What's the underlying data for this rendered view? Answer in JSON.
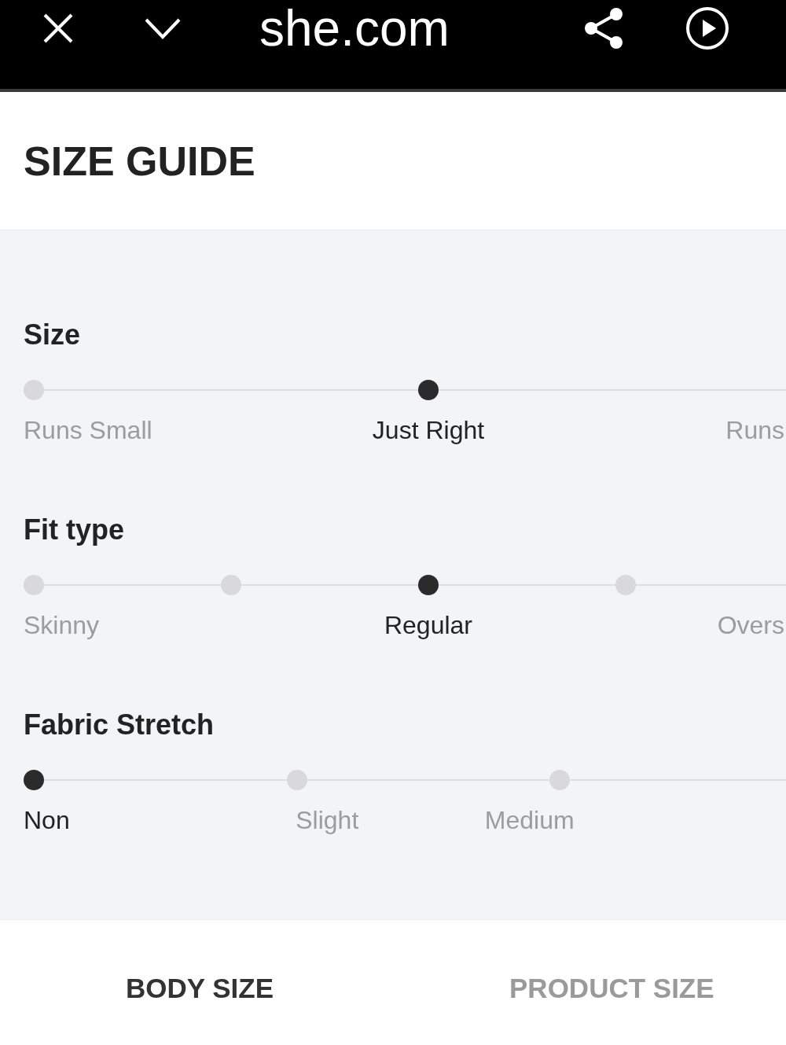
{
  "browser_bar": {
    "address": "she.com"
  },
  "header": {
    "title": "SIZE GUIDE"
  },
  "fit_scales": [
    {
      "title": "Size",
      "stops": [
        {
          "selected": false
        },
        {
          "selected": true
        }
      ],
      "labels": [
        {
          "text": "Runs Small",
          "selected": false
        },
        {
          "text": "Just Right",
          "selected": true
        },
        {
          "text": "Runs",
          "selected": false
        }
      ]
    },
    {
      "title": "Fit type",
      "stops": [
        {
          "selected": false
        },
        {
          "selected": false
        },
        {
          "selected": true
        },
        {
          "selected": false
        }
      ],
      "labels": [
        {
          "text": "Skinny",
          "selected": false
        },
        {
          "text": "Regular",
          "selected": true
        },
        {
          "text": "Overs",
          "selected": false
        }
      ]
    },
    {
      "title": "Fabric Stretch",
      "stops": [
        {
          "selected": true
        },
        {
          "selected": false
        },
        {
          "selected": false
        }
      ],
      "labels": [
        {
          "text": "Non",
          "selected": true
        },
        {
          "text": "Slight",
          "selected": false
        },
        {
          "text": "Medium",
          "selected": false
        }
      ]
    }
  ],
  "tabs": [
    {
      "label": "BODY SIZE",
      "selected": true
    },
    {
      "label": "PRODUCT SIZE",
      "selected": false
    }
  ]
}
